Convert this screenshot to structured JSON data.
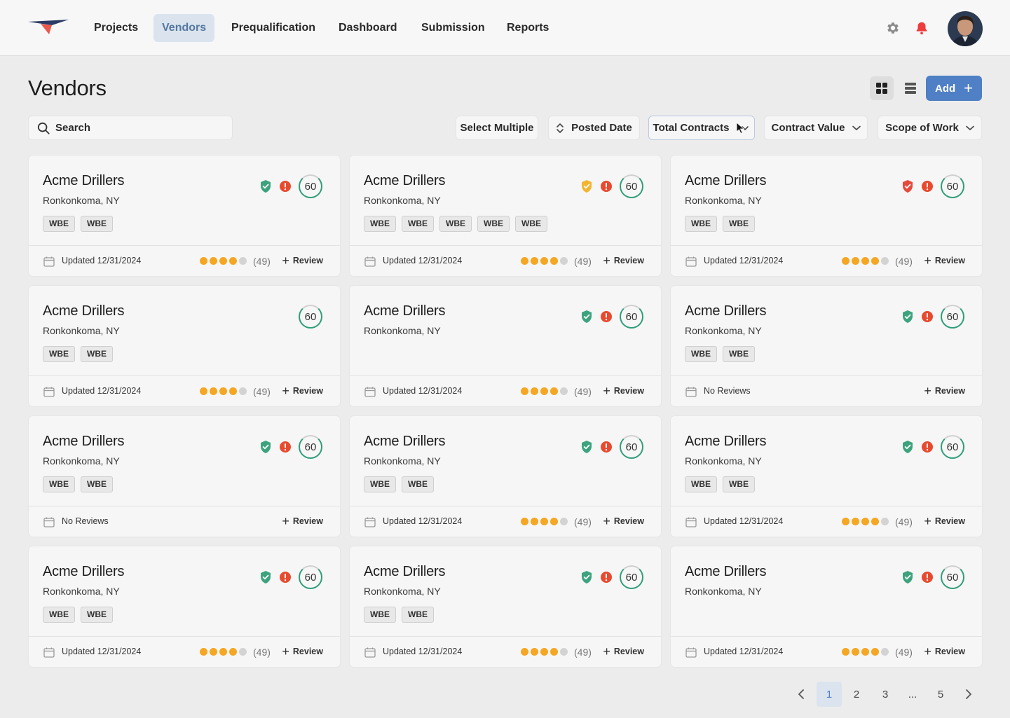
{
  "nav": {
    "items": [
      "Projects",
      "Vendors",
      "Prequalification",
      "Dashboard",
      "Submission",
      "Reports"
    ],
    "active": "Vendors"
  },
  "page": {
    "title": "Vendors",
    "add_label": "Add"
  },
  "search": {
    "placeholder": "Search"
  },
  "filters": {
    "select_multiple": "Select Multiple",
    "posted_date": "Posted Date",
    "total_contracts": "Total Contracts",
    "contract_value": "Contract Value",
    "scope_of_work": "Scope of Work"
  },
  "colors": {
    "accent": "#4f7fc5",
    "shield_green": "#3da37f",
    "shield_yellow": "#f2b531",
    "shield_red": "#e64a3d",
    "alert": "#e84a2f",
    "star": "#f5a623"
  },
  "cards": [
    {
      "name": "Acme Drillers",
      "location": "Ronkonkoma, NY",
      "tags": [
        "WBE",
        "WBE"
      ],
      "shield": "green",
      "alert": true,
      "score": "60",
      "updated": "Updated 12/31/2024",
      "rating": 4,
      "count": "(49)",
      "review": "Review"
    },
    {
      "name": "Acme Drillers",
      "location": "Ronkonkoma, NY",
      "tags": [
        "WBE",
        "WBE",
        "WBE",
        "WBE",
        "WBE"
      ],
      "shield": "yellow",
      "alert": true,
      "score": "60",
      "updated": "Updated 12/31/2024",
      "rating": 4,
      "count": "(49)",
      "review": "Review"
    },
    {
      "name": "Acme Drillers",
      "location": "Ronkonkoma, NY",
      "tags": [
        "WBE",
        "WBE"
      ],
      "shield": "red",
      "alert": true,
      "score": "60",
      "updated": "Updated 12/31/2024",
      "rating": 4,
      "count": "(49)",
      "review": "Review"
    },
    {
      "name": "Acme Drillers",
      "location": "Ronkonkoma, NY",
      "tags": [
        "WBE",
        "WBE"
      ],
      "shield": "",
      "alert": false,
      "score": "60",
      "updated": "Updated 12/31/2024",
      "rating": 4,
      "count": "(49)",
      "review": "Review"
    },
    {
      "name": "Acme Drillers",
      "location": "Ronkonkoma, NY",
      "tags": [],
      "shield": "green",
      "alert": true,
      "score": "60",
      "updated": "Updated 12/31/2024",
      "rating": 4,
      "count": "(49)",
      "review": "Review"
    },
    {
      "name": "Acme Drillers",
      "location": "Ronkonkoma, NY",
      "tags": [
        "WBE",
        "WBE"
      ],
      "shield": "green",
      "alert": true,
      "score": "60",
      "updated": "No Reviews",
      "rating": 0,
      "count": "",
      "review": "Review"
    },
    {
      "name": "Acme Drillers",
      "location": "Ronkonkoma, NY",
      "tags": [
        "WBE",
        "WBE"
      ],
      "shield": "green",
      "alert": true,
      "score": "60",
      "updated": "No Reviews",
      "rating": 0,
      "count": "",
      "review": "Review"
    },
    {
      "name": "Acme Drillers",
      "location": "Ronkonkoma, NY",
      "tags": [
        "WBE",
        "WBE"
      ],
      "shield": "green",
      "alert": true,
      "score": "60",
      "updated": "Updated 12/31/2024",
      "rating": 4,
      "count": "(49)",
      "review": "Review"
    },
    {
      "name": "Acme Drillers",
      "location": "Ronkonkoma, NY",
      "tags": [
        "WBE",
        "WBE"
      ],
      "shield": "green",
      "alert": true,
      "score": "60",
      "updated": "Updated 12/31/2024",
      "rating": 4,
      "count": "(49)",
      "review": "Review"
    },
    {
      "name": "Acme Drillers",
      "location": "Ronkonkoma, NY",
      "tags": [
        "WBE",
        "WBE"
      ],
      "shield": "green",
      "alert": true,
      "score": "60",
      "updated": "Updated 12/31/2024",
      "rating": 4,
      "count": "(49)",
      "review": "Review"
    },
    {
      "name": "Acme Drillers",
      "location": "Ronkonkoma, NY",
      "tags": [
        "WBE",
        "WBE"
      ],
      "shield": "green",
      "alert": true,
      "score": "60",
      "updated": "Updated 12/31/2024",
      "rating": 4,
      "count": "(49)",
      "review": "Review"
    },
    {
      "name": "Acme Drillers",
      "location": "Ronkonkoma, NY",
      "tags": [],
      "shield": "green",
      "alert": true,
      "score": "60",
      "updated": "Updated 12/31/2024",
      "rating": 4,
      "count": "(49)",
      "review": "Review"
    }
  ],
  "pagination": {
    "pages": [
      "1",
      "2",
      "3",
      "...",
      "5"
    ],
    "current": "1"
  }
}
